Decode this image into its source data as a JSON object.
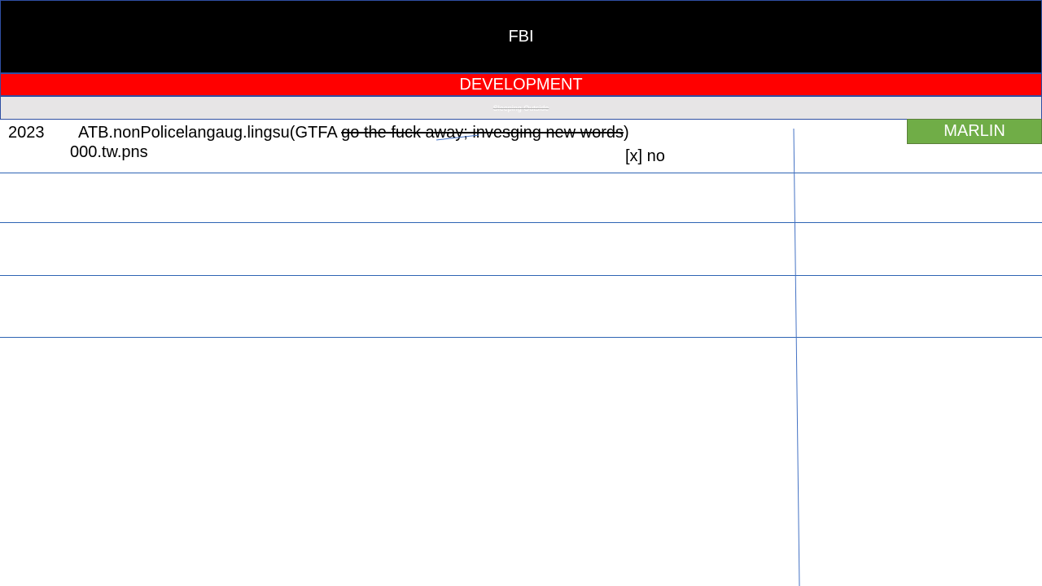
{
  "header": {
    "title": "FBI"
  },
  "banner": {
    "label": "DEVELOPMENT"
  },
  "subbar": {
    "label": "Sleeping Outside"
  },
  "tag": {
    "label": "MARLIN"
  },
  "entry": {
    "year": "2023",
    "code_prefix": "ATB.nonPolicelangaug.lingsu(GTFA",
    "struck_text": "go the fuck away; invesging new words",
    "code_suffix": ")",
    "file": "000.tw.pns",
    "checkbox_label": "[x] no"
  },
  "colors": {
    "header_bg": "#000000",
    "banner_bg": "#ff0000",
    "subbar_bg": "#e7e5e6",
    "tag_bg": "#70ad47",
    "rule": "#2e64b4"
  }
}
